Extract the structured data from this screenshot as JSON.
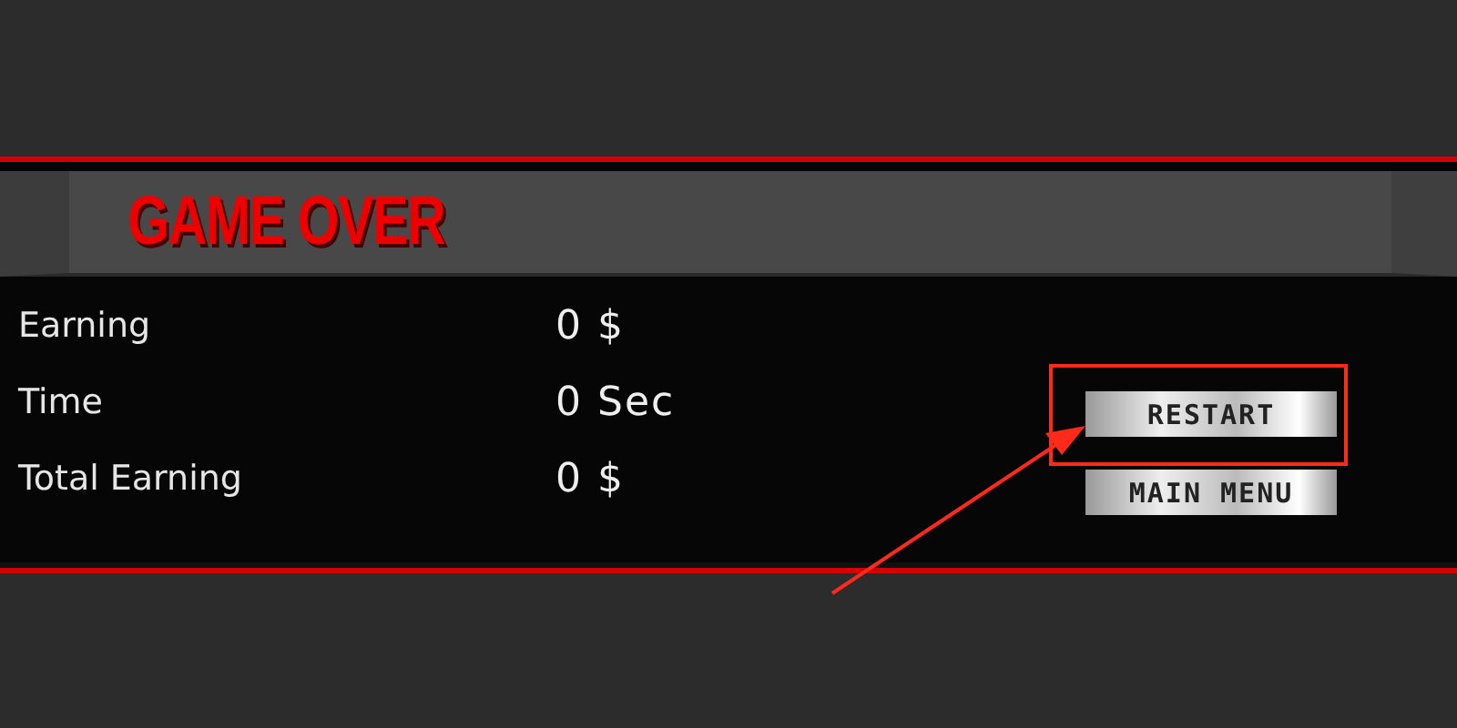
{
  "title": "GAME OVER",
  "stats": [
    {
      "label": "Earning",
      "value": "0 $"
    },
    {
      "label": "Time",
      "value": "0 Sec"
    },
    {
      "label": "Total Earning",
      "value": "0 $"
    }
  ],
  "buttons": [
    {
      "label": "RESTART"
    },
    {
      "label": "MAIN MENU"
    }
  ]
}
